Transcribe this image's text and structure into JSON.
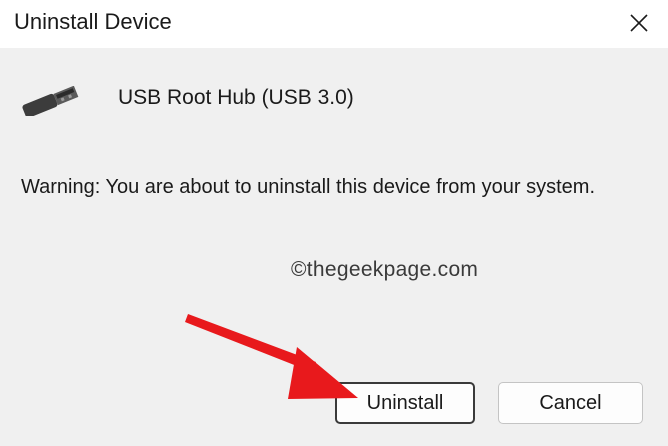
{
  "window": {
    "title": "Uninstall Device",
    "close_icon": "close-icon"
  },
  "device": {
    "icon": "usb-connector-icon",
    "name": "USB Root Hub (USB 3.0)"
  },
  "warning_text": "Warning: You are about to uninstall this device from your system.",
  "watermark": "©thegeekpage.com",
  "buttons": {
    "uninstall_label": "Uninstall",
    "cancel_label": "Cancel"
  },
  "annotation": {
    "arrow_color": "#e8191c"
  }
}
